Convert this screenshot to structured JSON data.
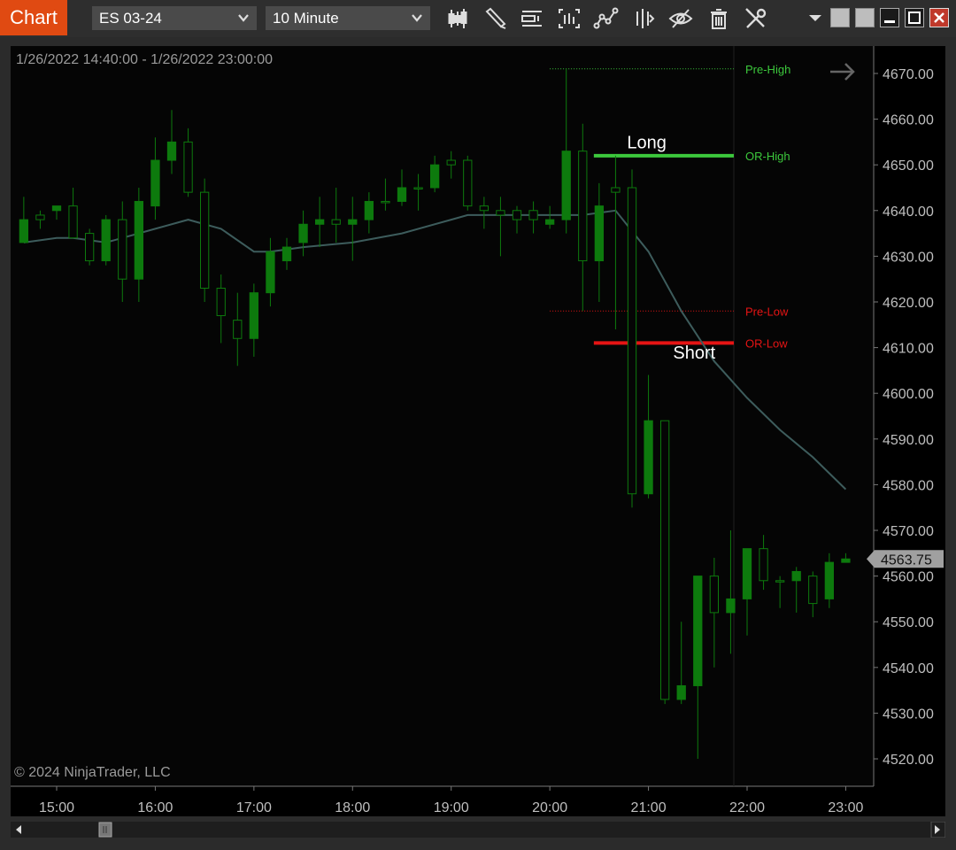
{
  "toolbar": {
    "tab_label": "Chart",
    "instrument": "ES 03-24",
    "interval": "10 Minute",
    "tools": [
      "bar-style-icon",
      "draw-pencil-icon",
      "chart-trader-icon",
      "data-box-icon",
      "indicators-icon",
      "strategies-icon",
      "show-hide-icon",
      "clear-trash-icon",
      "properties-wrench-icon"
    ]
  },
  "chart_header": {
    "range": "1/26/2022 14:40:00 - 1/26/2022 23:00:00",
    "copyright": "© 2024 NinjaTrader, LLC"
  },
  "colors": {
    "up_candle": "#0d7a0d",
    "down_candle_outline": "#0d7a0d",
    "sma": "#3d5c5c",
    "or_high": "#3cc83c",
    "or_low": "#e61414",
    "pre_high": "#3cc83c",
    "pre_low": "#e61414",
    "axis_text": "#bfbfbf",
    "last_price_bg": "#a0a0a0"
  },
  "chart_data": {
    "type": "candlestick",
    "y_axis": {
      "ticks": [
        4520,
        4530,
        4540,
        4550,
        4560,
        4570,
        4580,
        4590,
        4600,
        4610,
        4620,
        4630,
        4640,
        4650,
        4660,
        4670
      ],
      "tick_labels": [
        "4520.00",
        "4530.00",
        "4540.00",
        "4550.00",
        "4560.00",
        "4570.00",
        "4580.00",
        "4590.00",
        "4600.00",
        "4610.00",
        "4620.00",
        "4630.00",
        "4640.00",
        "4650.00",
        "4660.00",
        "4670.00"
      ],
      "ylim": [
        4514,
        4676
      ]
    },
    "x_axis": {
      "tick_labels": [
        "15:00",
        "16:00",
        "17:00",
        "18:00",
        "19:00",
        "20:00",
        "21:00",
        "22:00",
        "23:00"
      ],
      "tick_times": [
        "15:00",
        "16:00",
        "17:00",
        "18:00",
        "19:00",
        "20:00",
        "21:00",
        "22:00",
        "23:00"
      ],
      "xlim": [
        "14:32",
        "23:17"
      ]
    },
    "candles": [
      {
        "t": "14:40",
        "o": 4638,
        "h": 4643,
        "l": 4634,
        "c": 4633,
        "up": true
      },
      {
        "t": "14:50",
        "o": 4638,
        "h": 4640,
        "l": 4636,
        "c": 4639,
        "up": false
      },
      {
        "t": "15:00",
        "o": 4640,
        "h": 4641,
        "l": 4638,
        "c": 4641,
        "up": true
      },
      {
        "t": "15:10",
        "o": 4641,
        "h": 4645,
        "l": 4634,
        "c": 4634,
        "up": false
      },
      {
        "t": "15:20",
        "o": 4635,
        "h": 4636,
        "l": 4628,
        "c": 4629,
        "up": false
      },
      {
        "t": "15:30",
        "o": 4629,
        "h": 4639,
        "l": 4628,
        "c": 4638,
        "up": true
      },
      {
        "t": "15:40",
        "o": 4638,
        "h": 4642,
        "l": 4620,
        "c": 4625,
        "up": false
      },
      {
        "t": "15:50",
        "o": 4625,
        "h": 4645,
        "l": 4620,
        "c": 4642,
        "up": true
      },
      {
        "t": "16:00",
        "o": 4641,
        "h": 4656,
        "l": 4638,
        "c": 4651,
        "up": true
      },
      {
        "t": "16:10",
        "o": 4651,
        "h": 4662,
        "l": 4648,
        "c": 4655,
        "up": true
      },
      {
        "t": "16:20",
        "o": 4655,
        "h": 4658,
        "l": 4643,
        "c": 4644,
        "up": false
      },
      {
        "t": "16:30",
        "o": 4644,
        "h": 4647,
        "l": 4620,
        "c": 4623,
        "up": false
      },
      {
        "t": "16:40",
        "o": 4623,
        "h": 4626,
        "l": 4611,
        "c": 4617,
        "up": false
      },
      {
        "t": "16:50",
        "o": 4616,
        "h": 4622,
        "l": 4606,
        "c": 4612,
        "up": false
      },
      {
        "t": "17:00",
        "o": 4612,
        "h": 4624,
        "l": 4608,
        "c": 4622,
        "up": true
      },
      {
        "t": "17:10",
        "o": 4622,
        "h": 4634,
        "l": 4619,
        "c": 4631,
        "up": true
      },
      {
        "t": "17:20",
        "o": 4629,
        "h": 4634,
        "l": 4627,
        "c": 4632,
        "up": true
      },
      {
        "t": "17:30",
        "o": 4633,
        "h": 4640,
        "l": 4630,
        "c": 4637,
        "up": true
      },
      {
        "t": "17:40",
        "o": 4637,
        "h": 4643,
        "l": 4632,
        "c": 4638,
        "up": true
      },
      {
        "t": "17:50",
        "o": 4638,
        "h": 4645,
        "l": 4633,
        "c": 4637,
        "up": false
      },
      {
        "t": "18:00",
        "o": 4637,
        "h": 4643,
        "l": 4629,
        "c": 4638,
        "up": true
      },
      {
        "t": "18:10",
        "o": 4638,
        "h": 4644,
        "l": 4635,
        "c": 4642,
        "up": true
      },
      {
        "t": "18:20",
        "o": 4642,
        "h": 4647,
        "l": 4640,
        "c": 4642,
        "up": false
      },
      {
        "t": "18:30",
        "o": 4642,
        "h": 4649,
        "l": 4641,
        "c": 4645,
        "up": true
      },
      {
        "t": "18:40",
        "o": 4645,
        "h": 4648,
        "l": 4640,
        "c": 4645,
        "up": false
      },
      {
        "t": "18:50",
        "o": 4645,
        "h": 4652,
        "l": 4644,
        "c": 4650,
        "up": true
      },
      {
        "t": "19:00",
        "o": 4650,
        "h": 4653,
        "l": 4647,
        "c": 4651,
        "up": false
      },
      {
        "t": "19:10",
        "o": 4651,
        "h": 4652,
        "l": 4640,
        "c": 4641,
        "up": false
      },
      {
        "t": "19:20",
        "o": 4641,
        "h": 4643,
        "l": 4636,
        "c": 4640,
        "up": false
      },
      {
        "t": "19:30",
        "o": 4640,
        "h": 4643,
        "l": 4630,
        "c": 4639,
        "up": false
      },
      {
        "t": "19:40",
        "o": 4638,
        "h": 4641,
        "l": 4635,
        "c": 4640,
        "up": false
      },
      {
        "t": "19:50",
        "o": 4640,
        "h": 4642,
        "l": 4635,
        "c": 4638,
        "up": false
      },
      {
        "t": "20:00",
        "o": 4637,
        "h": 4641,
        "l": 4636,
        "c": 4638,
        "up": true
      },
      {
        "t": "20:10",
        "o": 4638,
        "h": 4671,
        "l": 4635,
        "c": 4653,
        "up": true
      },
      {
        "t": "20:20",
        "o": 4653,
        "h": 4659,
        "l": 4618,
        "c": 4629,
        "up": false
      },
      {
        "t": "20:30",
        "o": 4629,
        "h": 4646,
        "l": 4620,
        "c": 4641,
        "up": true
      },
      {
        "t": "20:40",
        "o": 4644,
        "h": 4652,
        "l": 4614,
        "c": 4645,
        "up": false
      },
      {
        "t": "20:50",
        "o": 4645,
        "h": 4649,
        "l": 4575,
        "c": 4578,
        "up": false
      },
      {
        "t": "21:00",
        "o": 4578,
        "h": 4604,
        "l": 4577,
        "c": 4594,
        "up": true
      },
      {
        "t": "21:10",
        "o": 4594,
        "h": 4594,
        "l": 4532,
        "c": 4533,
        "up": false
      },
      {
        "t": "21:20",
        "o": 4533,
        "h": 4550,
        "l": 4532,
        "c": 4536,
        "up": true
      },
      {
        "t": "21:30",
        "o": 4536,
        "h": 4560,
        "l": 4520,
        "c": 4560,
        "up": true
      },
      {
        "t": "21:40",
        "o": 4560,
        "h": 4564,
        "l": 4540,
        "c": 4552,
        "up": false
      },
      {
        "t": "21:50",
        "o": 4552,
        "h": 4570,
        "l": 4543,
        "c": 4555,
        "up": true
      },
      {
        "t": "22:00",
        "o": 4555,
        "h": 4566,
        "l": 4547,
        "c": 4566,
        "up": true
      },
      {
        "t": "22:10",
        "o": 4566,
        "h": 4569,
        "l": 4557,
        "c": 4559,
        "up": false
      },
      {
        "t": "22:20",
        "o": 4559,
        "h": 4560,
        "l": 4553,
        "c": 4559,
        "up": false
      },
      {
        "t": "22:30",
        "o": 4559,
        "h": 4562,
        "l": 4552,
        "c": 4561,
        "up": true
      },
      {
        "t": "22:40",
        "o": 4560,
        "h": 4561,
        "l": 4551,
        "c": 4554,
        "up": false
      },
      {
        "t": "22:50",
        "o": 4555,
        "h": 4565,
        "l": 4553,
        "c": 4563,
        "up": true
      },
      {
        "t": "23:00",
        "o": 4563,
        "h": 4565,
        "l": 4563,
        "c": 4563.75,
        "up": true
      }
    ],
    "sma": [
      {
        "t": "14:40",
        "v": 4633
      },
      {
        "t": "15:00",
        "v": 4634
      },
      {
        "t": "15:10",
        "v": 4634
      },
      {
        "t": "15:30",
        "v": 4633
      },
      {
        "t": "16:00",
        "v": 4636
      },
      {
        "t": "16:20",
        "v": 4638
      },
      {
        "t": "16:40",
        "v": 4636
      },
      {
        "t": "17:00",
        "v": 4631
      },
      {
        "t": "17:10",
        "v": 4631
      },
      {
        "t": "17:30",
        "v": 4632
      },
      {
        "t": "18:00",
        "v": 4633
      },
      {
        "t": "18:30",
        "v": 4635
      },
      {
        "t": "19:00",
        "v": 4638
      },
      {
        "t": "19:10",
        "v": 4639
      },
      {
        "t": "19:30",
        "v": 4639
      },
      {
        "t": "20:00",
        "v": 4639
      },
      {
        "t": "20:20",
        "v": 4639
      },
      {
        "t": "20:40",
        "v": 4640
      },
      {
        "t": "21:00",
        "v": 4631
      },
      {
        "t": "21:20",
        "v": 4618
      },
      {
        "t": "21:40",
        "v": 4607
      },
      {
        "t": "22:00",
        "v": 4599
      },
      {
        "t": "22:20",
        "v": 4592
      },
      {
        "t": "22:40",
        "v": 4586
      },
      {
        "t": "23:00",
        "v": 4579
      }
    ],
    "levels": [
      {
        "name": "Pre-High",
        "value": 4671,
        "color": "#3cc83c",
        "style": "dotted",
        "start": "20:00"
      },
      {
        "name": "OR-High",
        "value": 4652,
        "color": "#3cc83c",
        "style": "solid-thick",
        "start": "20:30"
      },
      {
        "name": "Pre-Low",
        "value": 4618,
        "color": "#e61414",
        "style": "dotted",
        "start": "20:00"
      },
      {
        "name": "OR-Low",
        "value": 4611,
        "color": "#e61414",
        "style": "solid-thick",
        "start": "20:30"
      }
    ],
    "annotations": [
      {
        "text": "Long",
        "value": 4655,
        "t": "20:47"
      },
      {
        "text": "Short",
        "value": 4609,
        "t": "21:15"
      }
    ],
    "last_price": "4563.75",
    "last_price_value": 4563.75
  }
}
